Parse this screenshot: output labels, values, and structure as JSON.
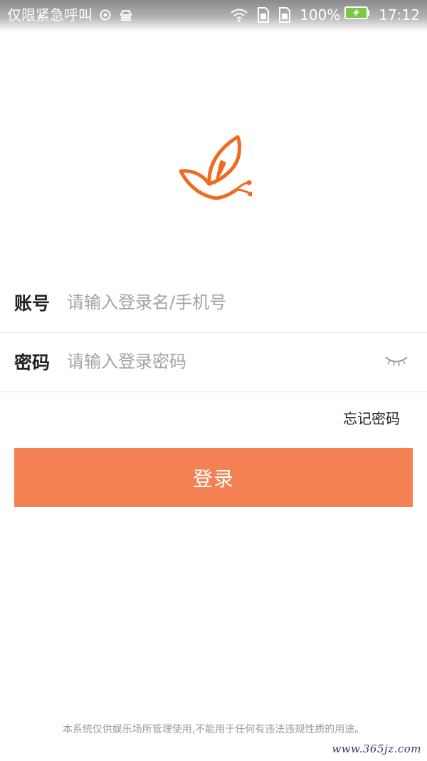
{
  "status_bar": {
    "carrier": "仅限紧急呼叫",
    "battery_percent": "100%",
    "time": "17:12",
    "icons": [
      "location-icon",
      "android-debug-icon",
      "wifi-icon",
      "sim1-icon",
      "sim2-icon",
      "battery-charging-icon"
    ]
  },
  "logo": {
    "icon": "butterfly-logo-icon",
    "color": "#f06a21"
  },
  "form": {
    "account_label": "账号",
    "account_placeholder": "请输入登录名/手机号",
    "password_label": "密码",
    "password_placeholder": "请输入登录密码",
    "eye_icon": "eye-closed-icon",
    "forgot_label": "忘记密码"
  },
  "login_button": {
    "label": "登录",
    "color": "#f38153"
  },
  "footer": {
    "disclaimer": "本系统仅供娱乐场所管理使用,不能用于任何有违法违规性质的用途。",
    "watermark": "www.365jz.com"
  }
}
